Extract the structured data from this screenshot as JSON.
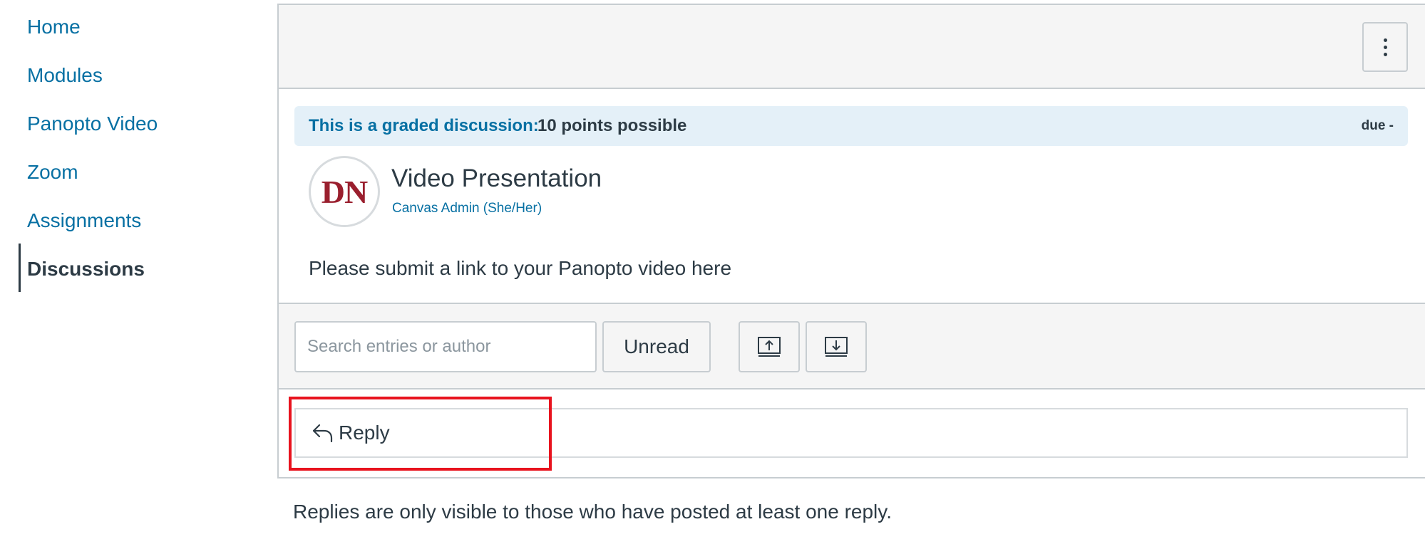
{
  "nav": {
    "items": [
      {
        "label": "Home"
      },
      {
        "label": "Modules"
      },
      {
        "label": "Panopto Video"
      },
      {
        "label": "Zoom"
      },
      {
        "label": "Assignments"
      },
      {
        "label": "Discussions"
      }
    ],
    "active": "Discussions"
  },
  "header": {
    "menu_icon": "kebab-menu-icon"
  },
  "graded": {
    "label": "This is a graded discussion:",
    "points": "10 points possible",
    "due": "due -"
  },
  "post": {
    "avatar_initials": "DN",
    "title": "Video Presentation",
    "author": "Canvas Admin (She/Her)",
    "body": "Please submit a link to your Panopto video here"
  },
  "toolbar": {
    "search_placeholder": "Search entries or author",
    "unread_label": "Unread",
    "expand_icon": "expand-upload-icon",
    "collapse_icon": "collapse-download-icon"
  },
  "reply": {
    "label": "Reply",
    "icon": "reply-arrow-icon"
  },
  "note": "Replies are only visible to those who have posted at least one reply.",
  "colors": {
    "link": "#0770a3",
    "text": "#2d3b45",
    "banner_bg": "#e4f0f8",
    "highlight": "#e8131e",
    "avatar_text": "#9a1f2e"
  }
}
